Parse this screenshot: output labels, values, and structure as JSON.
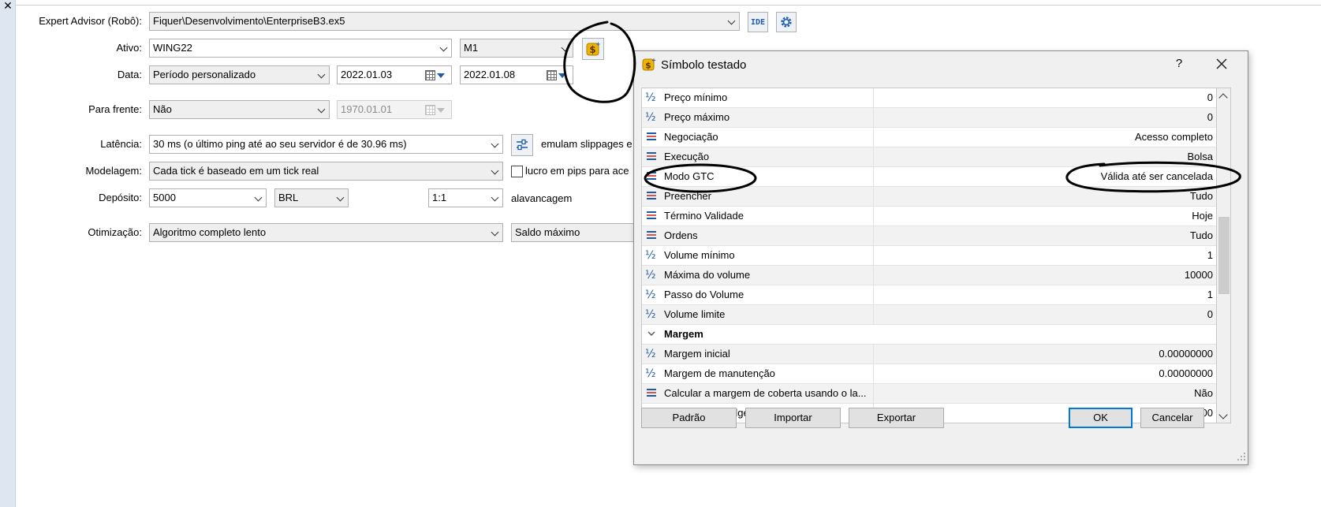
{
  "form": {
    "expert_label": "Expert Advisor (Robô):",
    "expert_value": "Fiquer\\Desenvolvimento\\EnterpriseB3.ex5",
    "ide_label": "IDE",
    "ativo_label": "Ativo:",
    "ativo_value": "WING22",
    "timeframe_value": "M1",
    "data_label": "Data:",
    "periodo_value": "Período personalizado",
    "date_from": "2022.01.03",
    "date_to": "2022.01.08",
    "para_frente_label": "Para frente:",
    "para_frente_value": "Não",
    "para_frente_date": "1970.01.01",
    "latencia_label": "Latência:",
    "latencia_value": "30 ms (o último ping até ao seu servidor é de 30.96 ms)",
    "latencia_note": "emulam slippages e",
    "modelagem_label": "Modelagem:",
    "modelagem_value": "Cada tick é baseado em um tick real",
    "lucro_label": "lucro em pips para ace",
    "deposito_label": "Depósito:",
    "deposito_value": "5000",
    "moeda_value": "BRL",
    "alavancagem_value": "1:1",
    "alavancagem_label": "alavancagem",
    "otimizacao_label": "Otimização:",
    "otimizacao_value": "Algoritmo completo lento",
    "criterio_value": "Saldo máximo"
  },
  "dialog": {
    "title": "Símbolo testado",
    "help": "?",
    "rows": [
      {
        "icon": "half-icon",
        "name": "Preço mínimo",
        "value": "0"
      },
      {
        "icon": "half-icon",
        "name": "Preço máximo",
        "value": "0"
      },
      {
        "icon": "list-icon",
        "name": "Negociação",
        "value": "Acesso completo"
      },
      {
        "icon": "list-icon",
        "name": "Execução",
        "value": "Bolsa"
      },
      {
        "icon": "list-icon",
        "name": "Modo GTC",
        "value": "Válida até ser cancelada"
      },
      {
        "icon": "list-icon",
        "name": "Preencher",
        "value": "Tudo"
      },
      {
        "icon": "list-icon",
        "name": "Término Validade",
        "value": "Hoje"
      },
      {
        "icon": "list-icon",
        "name": "Ordens",
        "value": "Tudo"
      },
      {
        "icon": "half-icon",
        "name": "Volume mínimo",
        "value": "1"
      },
      {
        "icon": "half-icon",
        "name": "Máxima do volume",
        "value": "10000"
      },
      {
        "icon": "half-icon",
        "name": "Passo do Volume",
        "value": "1"
      },
      {
        "icon": "half-icon",
        "name": "Volume limite",
        "value": "0"
      },
      {
        "icon": "chevron-down-icon",
        "name": "Margem",
        "value": "",
        "group": true
      },
      {
        "icon": "half-icon",
        "name": "Margem inicial",
        "value": "0.00000000"
      },
      {
        "icon": "half-icon",
        "name": "Margem de manutenção",
        "value": "0.00000000"
      },
      {
        "icon": "list-icon",
        "name": "Calcular a margem de coberta usando o la...",
        "value": "Não"
      },
      {
        "icon": "half-icon",
        "name": "Margem de Hedge",
        "value": "0.00000000"
      }
    ],
    "buttons": {
      "padrao": "Padrão",
      "importar": "Importar",
      "exportar": "Exportar",
      "ok": "OK",
      "cancelar": "Cancelar"
    }
  },
  "colors": {
    "accent": "#0078d7",
    "icon_blue": "#1e5aa8",
    "icon_red": "#d9534f",
    "coin_gold": "#f0b400"
  }
}
